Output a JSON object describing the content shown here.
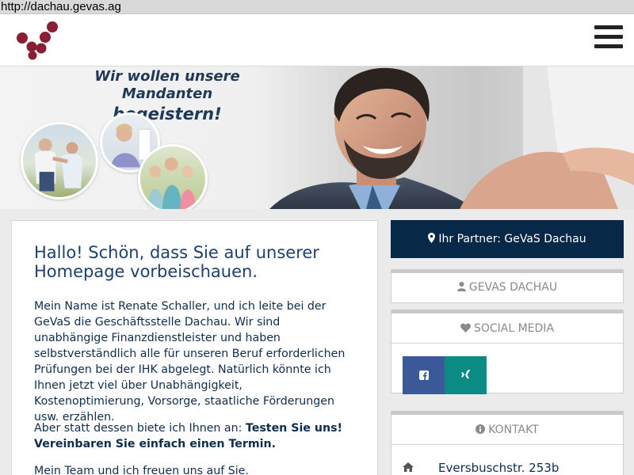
{
  "browser": {
    "url": "http://dachau.gevas.ag"
  },
  "header": {
    "logo_icon": "grapes-logo-icon",
    "menu_icon": "hamburger-menu-icon"
  },
  "hero": {
    "title_line1": "Wir wollen unsere Mandanten",
    "title_line2": "begeistern!"
  },
  "main": {
    "heading": "Hallo! Schön, dass Sie auf unserer Homepage vorbeischauen.",
    "paragraph1": "Mein Name ist Renate Schaller, und ich leite bei der GeVaS die Geschäftsstelle Dachau. Wir sind unabhängige Finanzdienstleister und haben selbstverständlich alle für unseren Beruf erforderlichen Prüfungen bei der IHK abgelegt. Natürlich könnte ich Ihnen jetzt viel über Unabhängigkeit, Kostenoptimierung, Vorsorge, staatliche Förderungen usw. erzählen.",
    "paragraph2_plain": "Aber statt dessen biete ich Ihnen an: ",
    "paragraph2_bold": "Testen Sie uns! Vereinbaren Sie einfach einen Termin.",
    "paragraph3": "Mein Team und ich freuen uns auf Sie."
  },
  "sidebar": {
    "partner_label": "Ihr Partner: GeVaS Dachau",
    "gevas_label": "GEVAS DACHAU",
    "social_label": "SOCIAL MEDIA",
    "social_buttons": [
      {
        "name": "facebook",
        "icon": "facebook-icon",
        "color": "#3b5998"
      },
      {
        "name": "xing",
        "icon": "xing-icon",
        "color": "#0a8c85"
      }
    ],
    "kontakt_label": "KONTAKT",
    "address": "Eversbuschstr. 253b"
  },
  "colors": {
    "navy": "#082848",
    "text": "#0f2d4d",
    "heading": "#1f3f6e",
    "logo_red": "#8a1e35"
  }
}
